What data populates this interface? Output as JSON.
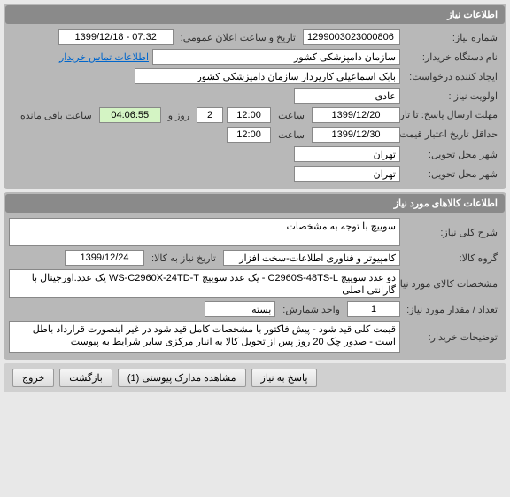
{
  "panel1": {
    "title": "اطلاعات نیاز",
    "need_number_label": "شماره نیاز:",
    "need_number": "1299003023000806",
    "public_announce_label": "تاریخ و ساعت اعلان عمومی:",
    "public_announce": "1399/12/18 - 07:32",
    "buyer_org_label": "نام دستگاه خریدار:",
    "buyer_org": "سازمان دامپزشکی کشور",
    "contact_link": "اطلاعات تماس خریدار",
    "creator_label": "ایجاد کننده درخواست:",
    "creator": "بابک اسماعیلی کارپرداز سازمان دامپزشکی کشور",
    "priority_label": "اولویت نیاز :",
    "priority": "عادی",
    "deadline_label": "مهلت ارسال پاسخ:",
    "until_label": "تا تاریخ :",
    "deadline_date": "1399/12/20",
    "time_label": "ساعت",
    "deadline_time": "12:00",
    "days_input": "2",
    "days_label": "روز و",
    "countdown": "04:06:55",
    "remain_label": "ساعت باقی مانده",
    "min_validity_label": "حداقل تاریخ اعتبار قیمت:",
    "min_validity_date": "1399/12/30",
    "min_validity_time": "12:00",
    "delivery_city_label": "شهر محل تحویل:",
    "delivery_city": "تهران",
    "delivery_city2_label": "شهر محل تحویل:",
    "delivery_city2": "تهران"
  },
  "panel2": {
    "title": "اطلاعات کالاهای مورد نیاز",
    "desc_label": "شرح کلی نیاز:",
    "desc": "سوییچ با توجه به مشخصات",
    "group_label": "گروه کالا:",
    "group": "کامپیوتر و فناوری اطلاعات-سخت افزار",
    "need_date_label": "تاریخ نیاز به کالا:",
    "need_date": "1399/12/24",
    "spec_label": "مشخصات کالای مورد نیاز:",
    "spec": "دو عدد سوییچ C2960S-48TS-L - یک عدد سوییچ WS-C2960X-24TD-T یک عدد.اورجینال با گارانتی اصلی",
    "qty_label": "تعداد / مقدار مورد نیاز:",
    "qty": "1",
    "unit_label": "واحد شمارش:",
    "unit": "بسته",
    "notes_label": "توضیحات خریدار:",
    "notes": "قیمت کلی قید شود - پیش فاکتور با مشخصات کامل قید شود در غیر اینصورت قرارداد باطل است - صدور چک 20 روز پس از تحویل کالا به انبار مرکزی سایر شرایط به پیوست"
  },
  "footer": {
    "reply": "پاسخ به نیاز",
    "attachments": "مشاهده مدارک پیوستی (1)",
    "back": "بازگشت",
    "exit": "خروج"
  }
}
